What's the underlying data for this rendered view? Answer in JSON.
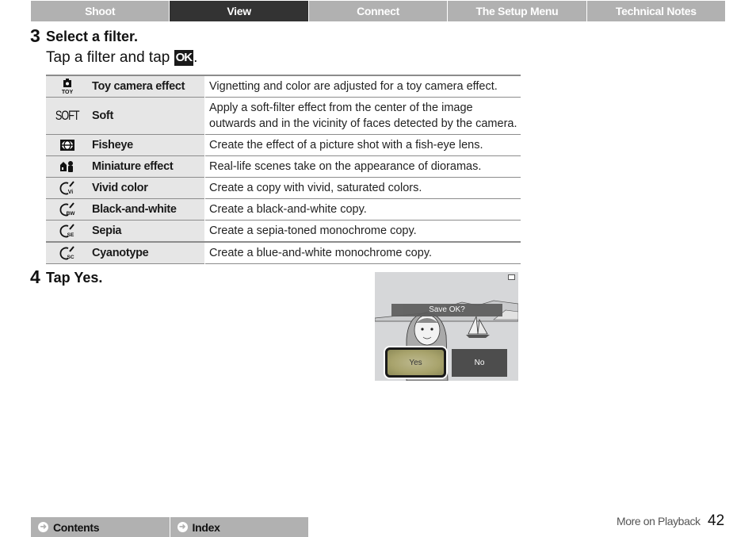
{
  "top_nav": {
    "tabs": [
      {
        "label": "Shoot",
        "active": false
      },
      {
        "label": "View",
        "active": true
      },
      {
        "label": "Connect",
        "active": false
      },
      {
        "label": "The Setup Menu",
        "active": false
      },
      {
        "label": "Technical Notes",
        "active": false
      }
    ]
  },
  "step3": {
    "number": "3",
    "title": "Select a filter.",
    "body_prefix": "Tap a filter and tap",
    "ok_glyph": "OK",
    "body_suffix": "."
  },
  "filters": [
    {
      "icon": "toy-camera-icon",
      "icon_text": "TOY",
      "name": "Toy camera effect",
      "description": "Vignetting and color are adjusted for a toy camera effect."
    },
    {
      "icon": "soft-icon",
      "icon_text": "SOFT",
      "name": "Soft",
      "description": "Apply a soft-filter effect from the center of the image outwards and in the vicinity of faces detected by the camera."
    },
    {
      "icon": "fisheye-icon",
      "icon_text": "",
      "name": "Fisheye",
      "description": "Create the effect of a picture shot with a fish-eye lens."
    },
    {
      "icon": "miniature-icon",
      "icon_text": "",
      "name": "Miniature effect",
      "description": "Real-life scenes take on the appearance of dioramas."
    },
    {
      "icon": "vivid-color-icon",
      "icon_text": "Vi",
      "name": "Vivid color",
      "description": "Create a copy with vivid, saturated colors."
    },
    {
      "icon": "black-and-white-icon",
      "icon_text": "BW",
      "name": "Black-and-white",
      "description": "Create a black-and-white copy."
    },
    {
      "icon": "sepia-icon",
      "icon_text": "SE",
      "name": "Sepia",
      "description": "Create a sepia-toned monochrome copy."
    },
    {
      "icon": "cyanotype-icon",
      "icon_text": "SC",
      "name": "Cyanotype",
      "description": "Create a blue-and-white monochrome copy."
    }
  ],
  "step4": {
    "number": "4",
    "title": "Tap Yes."
  },
  "camera_screen": {
    "prompt": "Save OK?",
    "yes_label": "Yes",
    "no_label": "No"
  },
  "bottom_nav": {
    "links": [
      {
        "label": "Contents"
      },
      {
        "label": "Index"
      }
    ]
  },
  "footer": {
    "section": "More on Playback",
    "page_number": "42"
  },
  "colors": {
    "nav_bg": "#b1b1b1",
    "nav_active_bg": "#333333",
    "table_label_bg": "#e6e6e6",
    "yes_button": "#a8a36c"
  }
}
